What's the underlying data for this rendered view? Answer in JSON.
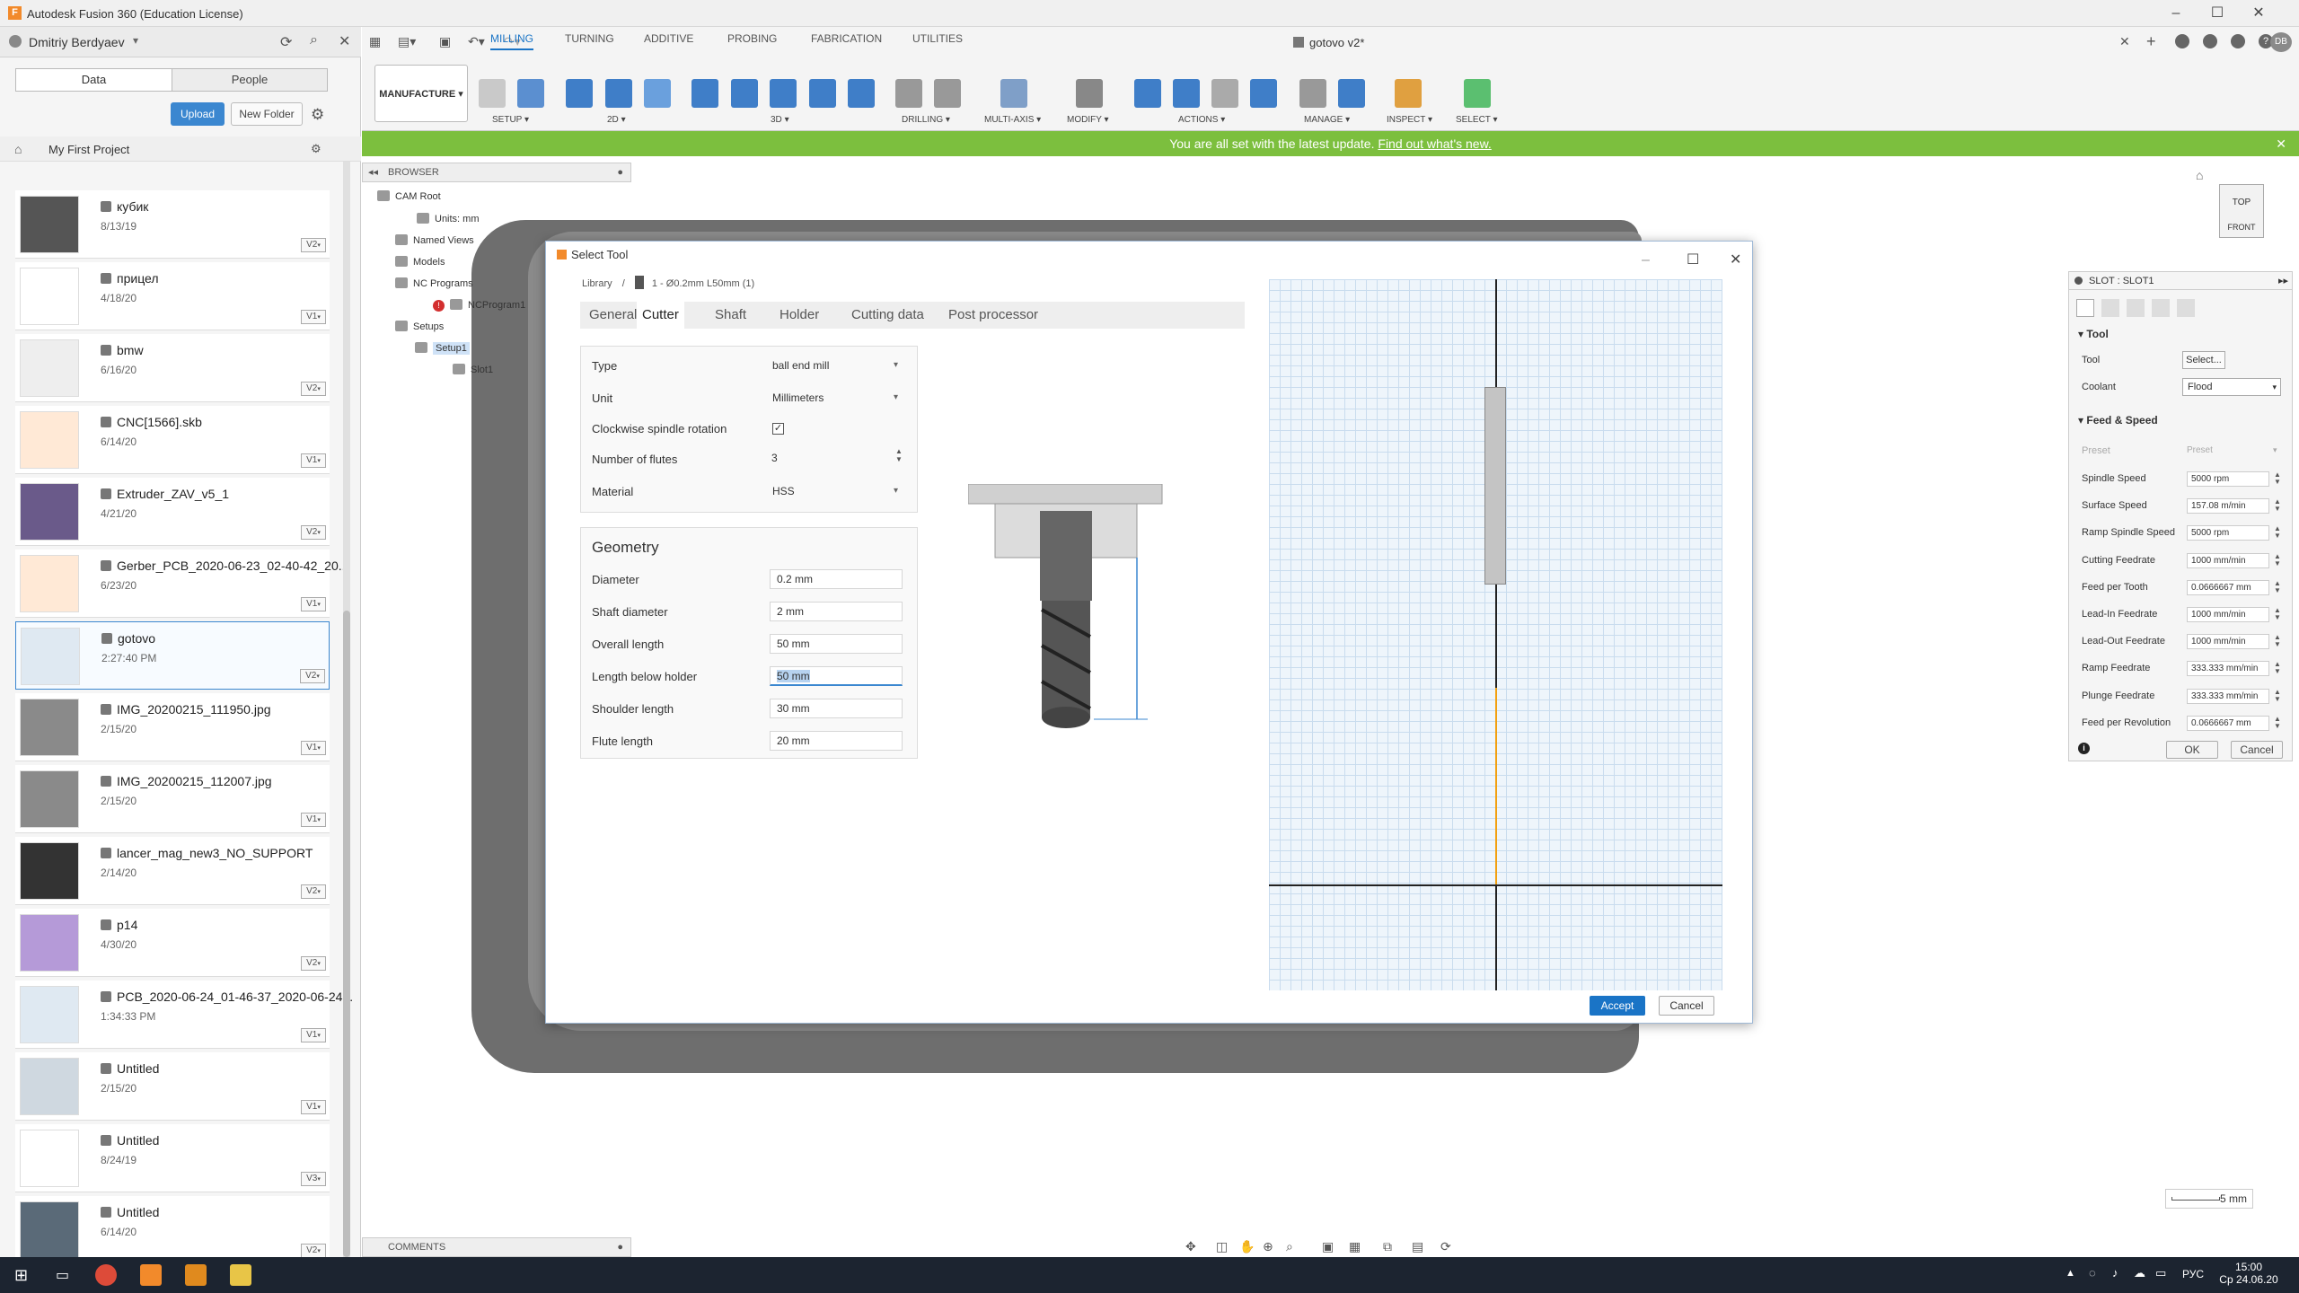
{
  "app": {
    "title": "Autodesk Fusion 360 (Education License)",
    "doc_title": "gotovo v2*"
  },
  "user": {
    "name": "Dmitriy Berdyaev",
    "initials": "DB"
  },
  "data_panel": {
    "tabs": [
      "Data",
      "People"
    ],
    "upload_label": "Upload",
    "new_folder_label": "New Folder",
    "project_name": "My First Project",
    "files": [
      {
        "name": "кубик",
        "date": "8/13/19",
        "version": "V2"
      },
      {
        "name": "прицел",
        "date": "4/18/20",
        "version": "V1"
      },
      {
        "name": "bmw",
        "date": "6/16/20",
        "version": "V2"
      },
      {
        "name": "CNC[1566].skb",
        "date": "6/14/20",
        "version": "V1"
      },
      {
        "name": "Extruder_ZAV_v5_1",
        "date": "4/21/20",
        "version": "V2"
      },
      {
        "name": "Gerber_PCB_2020-06-23_02-40-42_20...",
        "date": "6/23/20",
        "version": "V1"
      },
      {
        "name": "gotovo",
        "date": "2:27:40 PM",
        "version": "V2"
      },
      {
        "name": "IMG_20200215_111950.jpg",
        "date": "2/15/20",
        "version": "V1"
      },
      {
        "name": "IMG_20200215_112007.jpg",
        "date": "2/15/20",
        "version": "V1"
      },
      {
        "name": "lancer_mag_new3_NO_SUPPORT",
        "date": "2/14/20",
        "version": "V2"
      },
      {
        "name": "p14",
        "date": "4/30/20",
        "version": "V2"
      },
      {
        "name": "PCB_2020-06-24_01-46-37_2020-06-24...",
        "date": "1:34:33 PM",
        "version": "V1"
      },
      {
        "name": "Untitled",
        "date": "2/15/20",
        "version": "V1"
      },
      {
        "name": "Untitled",
        "date": "8/24/19",
        "version": "V3"
      },
      {
        "name": "Untitled",
        "date": "6/14/20",
        "version": "V2"
      }
    ]
  },
  "ribbon": {
    "workspace": "MANUFACTURE",
    "tabs": [
      "MILLING",
      "TURNING",
      "ADDITIVE",
      "PROBING",
      "FABRICATION",
      "UTILITIES"
    ],
    "groups": [
      "SETUP",
      "2D",
      "3D",
      "DRILLING",
      "MULTI-AXIS",
      "MODIFY",
      "ACTIONS",
      "MANAGE",
      "INSPECT",
      "SELECT"
    ]
  },
  "banner": {
    "text": "You are all set with the latest update.",
    "link": "Find out what's new."
  },
  "browser": {
    "title": "BROWSER",
    "nodes": [
      "CAM Root",
      "Units: mm",
      "Named Views",
      "Models",
      "NC Programs",
      "NCProgram1",
      "Setups",
      "Setup1",
      "Slot1"
    ]
  },
  "comments_label": "COMMENTS",
  "dialog": {
    "title": "Select Tool",
    "breadcrumb_root": "Library",
    "breadcrumb_sep": "/",
    "breadcrumb_tool": "1 - Ø0.2mm L50mm (1)",
    "tabs": [
      "General",
      "Cutter",
      "Shaft",
      "Holder",
      "Cutting data",
      "Post processor"
    ],
    "cutter": {
      "type_label": "Type",
      "type_value": "ball end mill",
      "unit_label": "Unit",
      "unit_value": "Millimeters",
      "cw_label": "Clockwise spindle rotation",
      "flutes_label": "Number of flutes",
      "flutes_value": "3",
      "material_label": "Material",
      "material_value": "HSS"
    },
    "geometry": {
      "title": "Geometry",
      "diameter_label": "Diameter",
      "diameter_value": "0.2 mm",
      "shaft_label": "Shaft diameter",
      "shaft_value": "2 mm",
      "overall_label": "Overall length",
      "overall_value": "50 mm",
      "below_label": "Length below holder",
      "below_value": "50 mm",
      "shoulder_label": "Shoulder length",
      "shoulder_value": "30 mm",
      "flute_label": "Flute length",
      "flute_value": "20 mm"
    },
    "scale_label": "5 mm",
    "accept_label": "Accept",
    "cancel_label": "Cancel"
  },
  "slot_panel": {
    "title": "SLOT : SLOT1",
    "tool_section": "Tool",
    "tool_label": "Tool",
    "tool_button": "Select...",
    "coolant_label": "Coolant",
    "coolant_value": "Flood",
    "feed_section": "Feed & Speed",
    "preset_label": "Preset",
    "preset_value": "Preset",
    "rows": [
      {
        "label": "Spindle Speed",
        "value": "5000 rpm"
      },
      {
        "label": "Surface Speed",
        "value": "157.08 m/min"
      },
      {
        "label": "Ramp Spindle Speed",
        "value": "5000 rpm"
      },
      {
        "label": "Cutting Feedrate",
        "value": "1000 mm/min"
      },
      {
        "label": "Feed per Tooth",
        "value": "0.0666667 mm"
      },
      {
        "label": "Lead-In Feedrate",
        "value": "1000 mm/min"
      },
      {
        "label": "Lead-Out Feedrate",
        "value": "1000 mm/min"
      },
      {
        "label": "Ramp Feedrate",
        "value": "333.333 mm/min"
      },
      {
        "label": "Plunge Feedrate",
        "value": "333.333 mm/min"
      },
      {
        "label": "Feed per Revolution",
        "value": "0.0666667 mm"
      }
    ],
    "ok_label": "OK",
    "cancel_label": "Cancel"
  },
  "viewcube": {
    "top": "TOP",
    "front": "FRONT"
  },
  "taskbar": {
    "lang": "РУС",
    "time": "15:00",
    "date": "Ср 24.06.20"
  },
  "colors": {
    "accent": "#1a74c6",
    "banner": "#7cbf3e",
    "fusion": "#f28a2b"
  }
}
